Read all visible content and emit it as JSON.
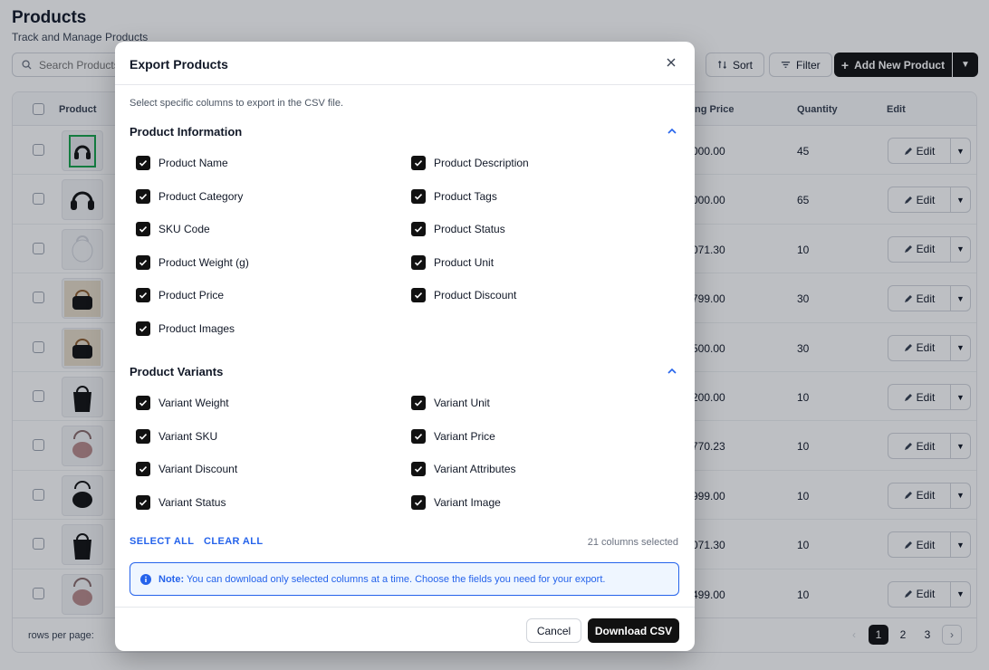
{
  "page": {
    "title": "Products",
    "subtitle": "Track and Manage Products",
    "search_placeholder": "Search Products",
    "sort_label": "Sort",
    "filter_label": "Filter",
    "add_label": "Add New Product"
  },
  "table": {
    "headers": {
      "product": "Product",
      "price": "ing Price",
      "quantity": "Quantity",
      "edit": "Edit"
    },
    "edit_label": "Edit",
    "rows": [
      {
        "price": "000.00",
        "qty": "45",
        "thumb": "headset-box"
      },
      {
        "price": "000.00",
        "qty": "65",
        "thumb": "headset"
      },
      {
        "price": "071.30",
        "qty": "10",
        "thumb": "white-bag"
      },
      {
        "price": "799.00",
        "qty": "30",
        "thumb": "black-bag"
      },
      {
        "price": "500.00",
        "qty": "30",
        "thumb": "black-bag"
      },
      {
        "price": "200.00",
        "qty": "10",
        "thumb": "black-tote"
      },
      {
        "price": "770.23",
        "qty": "10",
        "thumb": "pink-hobo"
      },
      {
        "price": "999.00",
        "qty": "10",
        "thumb": "black-hobo"
      },
      {
        "price": "071.30",
        "qty": "10",
        "thumb": "black-tote"
      },
      {
        "price": "499.00",
        "qty": "10",
        "thumb": "pink-hobo"
      }
    ],
    "rows_per_page_label": "rows per page:",
    "pages": [
      "1",
      "2",
      "3"
    ]
  },
  "modal": {
    "title": "Export Products",
    "description": "Select specific columns to export in the CSV file.",
    "sections": [
      {
        "title": "Product Information",
        "left": [
          "Product Name",
          "Product Category",
          "SKU Code",
          "Product Weight (g)",
          "Product Price",
          "Product Images"
        ],
        "right": [
          "Product Description",
          "Product Tags",
          "Product Status",
          "Product Unit",
          "Product Discount"
        ]
      },
      {
        "title": "Product Variants",
        "left": [
          "Variant Weight",
          "Variant SKU",
          "Variant Discount",
          "Variant Status"
        ],
        "right": [
          "Variant Unit",
          "Variant Price",
          "Variant Attributes",
          "Variant Image"
        ]
      }
    ],
    "select_all": "SELECT ALL",
    "clear_all": "CLEAR ALL",
    "count": "21 columns selected",
    "note_label": "Note:",
    "note_text": "You can download only selected columns at a time. Choose the fields you need for your export.",
    "cancel": "Cancel",
    "download": "Download CSV"
  },
  "colors": {
    "accent": "#2563eb",
    "primary": "#111111",
    "note_bg": "#eff6ff"
  }
}
